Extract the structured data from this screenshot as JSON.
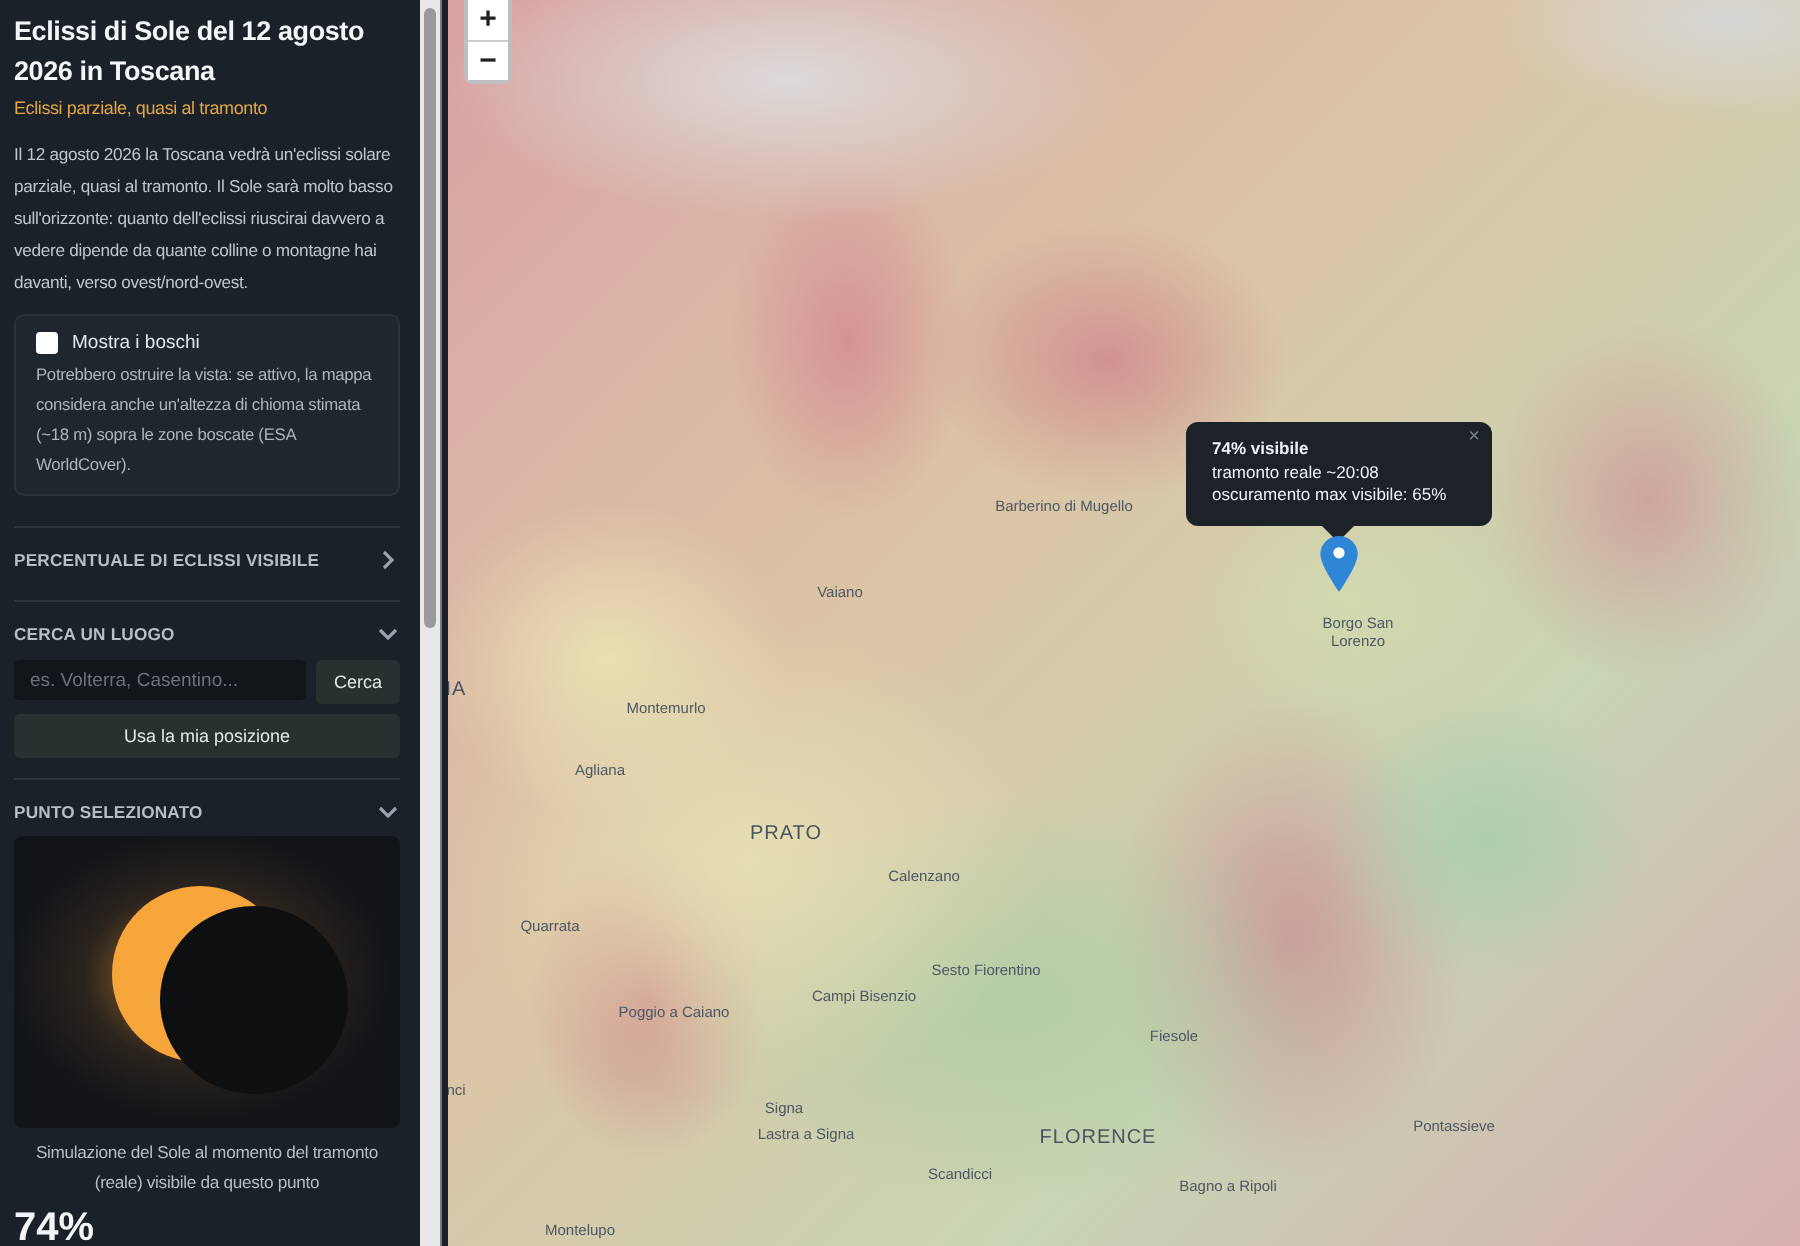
{
  "sidebar": {
    "title": "Eclissi di Sole del 12 agosto 2026 in Toscana",
    "subtitle": "Eclissi parziale, quasi al tramonto",
    "intro": "Il 12 agosto 2026 la Toscana vedrà un'eclissi solare parziale, quasi al tramonto. Il Sole sarà molto basso sull'orizzonte: quanto dell'eclissi riuscirai davvero a vedere dipende da quante colline o montagne hai davanti, verso ovest/nord-ovest.",
    "forest_option": {
      "label": "Mostra i boschi",
      "checked": false,
      "description": "Potrebbero ostruire la vista: se attivo, la mappa considera anche un'altezza di chioma stimata (~18 m) sopra le zone boscate (ESA WorldCover)."
    },
    "sections": [
      {
        "kind": "legend",
        "title": "PERCENTUALE DI ECLISSI VISIBILE",
        "expanded": false
      },
      {
        "kind": "search",
        "title": "CERCA UN LUOGO",
        "expanded": true,
        "placeholder": "es. Volterra, Casentino...",
        "search_button": "Cerca",
        "location_button": "Usa la mia posizione"
      },
      {
        "kind": "point",
        "title": "PUNTO SELEZIONATO",
        "expanded": true,
        "caption": "Simulazione del Sole al momento del tramonto (reale) visibile da questo punto",
        "percent": "74%"
      }
    ]
  },
  "map": {
    "zoom_in": "+",
    "zoom_out": "−",
    "places": [
      {
        "name": "Barberino di Mugello",
        "kind": "town"
      },
      {
        "name": "Vaiano",
        "kind": "town"
      },
      {
        "name": "IA",
        "kind": "city"
      },
      {
        "name": "Montemurlo",
        "kind": "town"
      },
      {
        "name": "Agliana",
        "kind": "town"
      },
      {
        "name": "PRATO",
        "kind": "city"
      },
      {
        "name": "Calenzano",
        "kind": "town"
      },
      {
        "name": "Quarrata",
        "kind": "town"
      },
      {
        "name": "Sesto Fiorentino",
        "kind": "town"
      },
      {
        "name": "Campi Bisenzio",
        "kind": "town"
      },
      {
        "name": "Poggio a Caiano",
        "kind": "town"
      },
      {
        "name": "nci",
        "kind": "town"
      },
      {
        "name": "Signa",
        "kind": "town"
      },
      {
        "name": "Lastra a Signa",
        "kind": "town"
      },
      {
        "name": "FLORENCE",
        "kind": "city"
      },
      {
        "name": "Scandicci",
        "kind": "town"
      },
      {
        "name": "Montelupo",
        "kind": "town"
      },
      {
        "name": "Borgo San Lorenzo",
        "kind": "town"
      },
      {
        "name": "Fiesole",
        "kind": "town"
      },
      {
        "name": "Pontassieve",
        "kind": "town"
      },
      {
        "name": "Bagno a Ripoli",
        "kind": "town"
      }
    ],
    "popup": {
      "title": "74% visibile",
      "lines": [
        "tramonto reale ~20:08",
        "oscuramento max visibile: 65%"
      ],
      "close": "×"
    }
  }
}
